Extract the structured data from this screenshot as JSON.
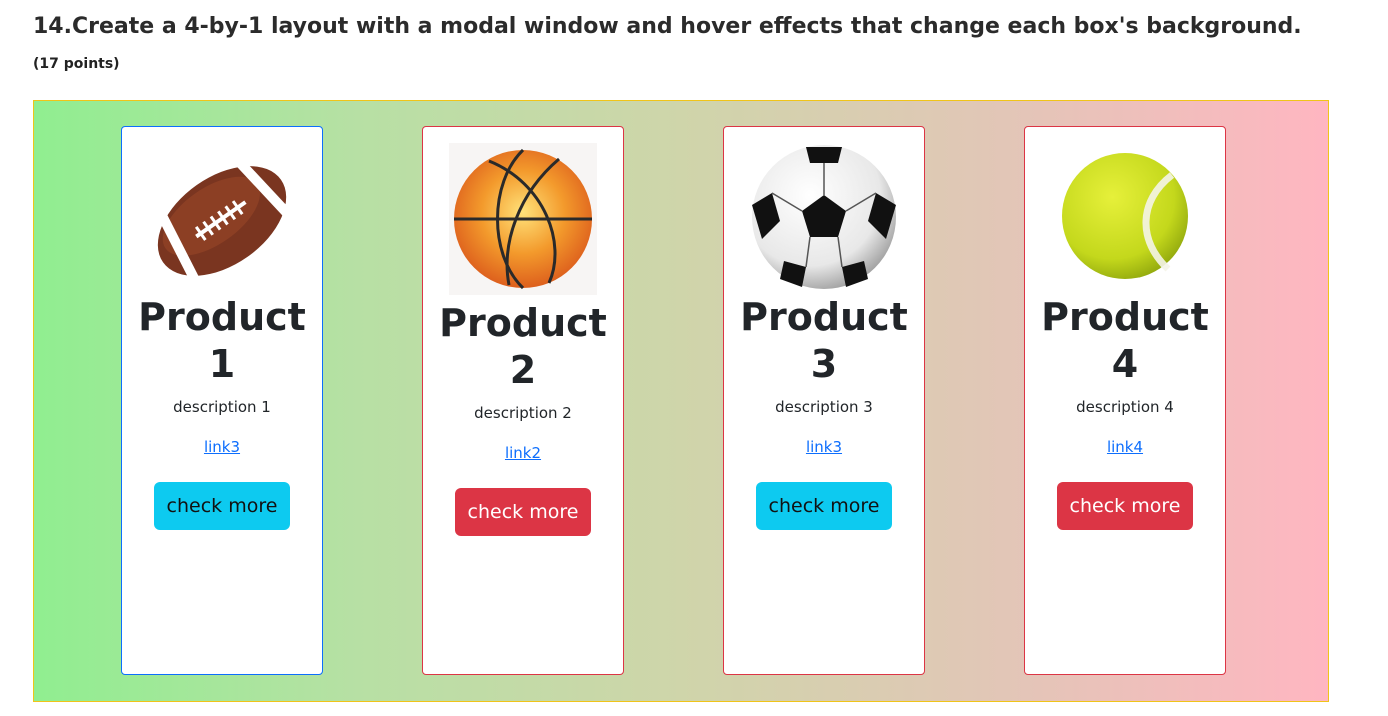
{
  "question": {
    "title": "14.Create a 4-by-1 layout with a modal window and hover effects that change each box's background.",
    "points": "(17 points)"
  },
  "colors": {
    "gradient_start": "#90ee90",
    "gradient_end": "#ffb6c1",
    "stage_border": "#f0c419",
    "info_button": "#0dcaf0",
    "danger_button": "#dc3545",
    "link": "#0d6efd",
    "active_card_border": "#0d6efd",
    "card_border": "#dc3545"
  },
  "cards": [
    {
      "image": "american-football-icon",
      "title_line1": "Product",
      "title_line2": "1",
      "description": "description 1",
      "link": "link3",
      "button": "check more",
      "button_style": "info"
    },
    {
      "image": "basketball-icon",
      "title_line1": "Product",
      "title_line2": "2",
      "description": "description 2",
      "link": "link2",
      "button": "check more",
      "button_style": "danger"
    },
    {
      "image": "soccer-ball-icon",
      "title_line1": "Product",
      "title_line2": "3",
      "description": "description 3",
      "link": "link3",
      "button": "check more",
      "button_style": "info"
    },
    {
      "image": "tennis-ball-icon",
      "title_line1": "Product",
      "title_line2": "4",
      "description": "description 4",
      "link": "link4",
      "button": "check more",
      "button_style": "danger"
    }
  ]
}
